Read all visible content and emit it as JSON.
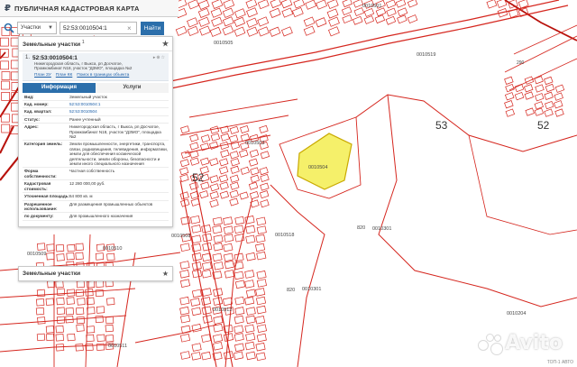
{
  "header": {
    "logo_glyph": "₽",
    "title": "ПУБЛИЧНАЯ КАДАСТРОВАЯ КАРТА"
  },
  "search": {
    "type": "Участки",
    "value": "52:53:0010504:1",
    "button": "Найти"
  },
  "panel": {
    "title": "Земельные участки",
    "count": "1",
    "item": {
      "index": "1.",
      "number": "52:53:0010504:1",
      "address": "Нижегородская область, г Выкса, рп Досчатое, Промкомбинат N18, участок \"ДЗМО\", площадка №2",
      "link_plan_zu": "План ЗУ",
      "link_plan_kk": "План КК",
      "link_border": "Поиск в границах объекта"
    },
    "tabs": [
      "Информация",
      "Услуги"
    ],
    "rows": [
      {
        "label": "Вид:",
        "value": "Земельный участок",
        "link": false
      },
      {
        "label": "Кад. номер:",
        "value": "52:53:0010504:1",
        "link": true
      },
      {
        "label": "Кад. квартал:",
        "value": "52:53:0010504",
        "link": true
      },
      {
        "label": "Статус:",
        "value": "Ранее учтенный",
        "link": false
      },
      {
        "label": "Адрес:",
        "value": "Нижегородская область, г Выкса, рп Досчатое, Промкомбинат N18, участок \"ДЗМО\", площадка №2",
        "link": false
      },
      {
        "label": "Категория земель:",
        "value": "Земли промышленности, энергетики, транспорта, связи, радиовещания, телевидения, информатики, земли для обеспечения космической деятельности, земли обороны, безопасности и земли иного специального назначения",
        "link": false
      },
      {
        "label": "Форма собственности:",
        "value": "Частная собственность",
        "link": false
      },
      {
        "label": "Кадастровая стоимость:",
        "value": "12 280 000,00 руб.",
        "link": false
      },
      {
        "label": "Уточненная площадь:",
        "value": "64 800 кв. м",
        "link": false
      },
      {
        "label": "Разрешенное использование:",
        "value": "Для размещения промышленных объектов",
        "link": false
      },
      {
        "label": "по документу:",
        "value": "Для промышленного назначения",
        "link": false
      }
    ]
  },
  "collapsed_panel": {
    "title": "Земельные участки"
  },
  "map": {
    "highlight_color": "#f5f06a",
    "parcel_color": "#d5261e",
    "quarter_labels": [
      "0010505",
      "0010501",
      "0010519",
      "0010503",
      "0010504",
      "0010518",
      "0010509",
      "0010510",
      "0010508",
      "0010512",
      "0010511",
      "0010301",
      "0010301",
      "0010204",
      "52",
      "52",
      "53",
      "290",
      "820",
      "820"
    ],
    "big_labels": [
      "52",
      "52",
      "53"
    ]
  },
  "watermark": {
    "text": "Avito",
    "sub": "ТОП-1 АВТО"
  }
}
